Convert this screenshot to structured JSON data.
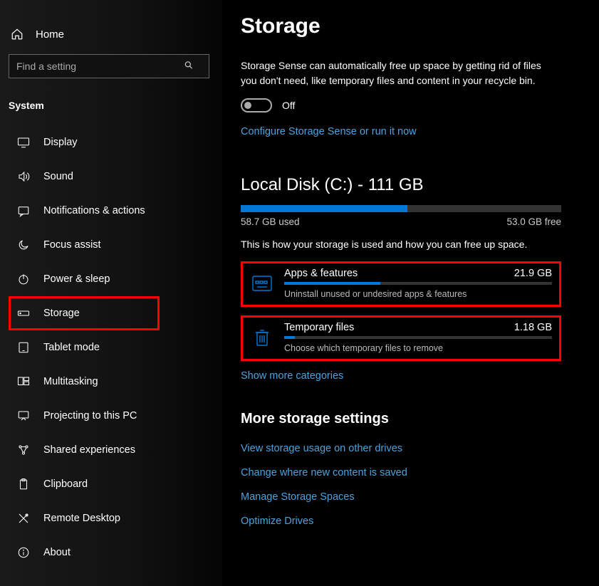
{
  "sidebar": {
    "home": "Home",
    "search_placeholder": "Find a setting",
    "section": "System",
    "items": [
      {
        "label": "Display"
      },
      {
        "label": "Sound"
      },
      {
        "label": "Notifications & actions"
      },
      {
        "label": "Focus assist"
      },
      {
        "label": "Power & sleep"
      },
      {
        "label": "Storage"
      },
      {
        "label": "Tablet mode"
      },
      {
        "label": "Multitasking"
      },
      {
        "label": "Projecting to this PC"
      },
      {
        "label": "Shared experiences"
      },
      {
        "label": "Clipboard"
      },
      {
        "label": "Remote Desktop"
      },
      {
        "label": "About"
      }
    ]
  },
  "main": {
    "title": "Storage",
    "sense_description": "Storage Sense can automatically free up space by getting rid of files you don't need, like temporary files and content in your recycle bin.",
    "toggle_state": "Off",
    "configure_link": "Configure Storage Sense or run it now",
    "disk": {
      "heading": "Local Disk (C:) - 111 GB",
      "used": "58.7 GB used",
      "free": "53.0 GB free",
      "fill_pct": 52,
      "usage_desc": "This is how your storage is used and how you can free up space."
    },
    "categories": [
      {
        "name": "Apps & features",
        "size": "21.9 GB",
        "sub": "Uninstall unused or undesired apps & features",
        "fill_pct": 36
      },
      {
        "name": "Temporary files",
        "size": "1.18 GB",
        "sub": "Choose which temporary files to remove",
        "fill_pct": 4
      }
    ],
    "show_more": "Show more categories",
    "more_settings_heading": "More storage settings",
    "links": [
      "View storage usage on other drives",
      "Change where new content is saved",
      "Manage Storage Spaces",
      "Optimize Drives"
    ]
  }
}
